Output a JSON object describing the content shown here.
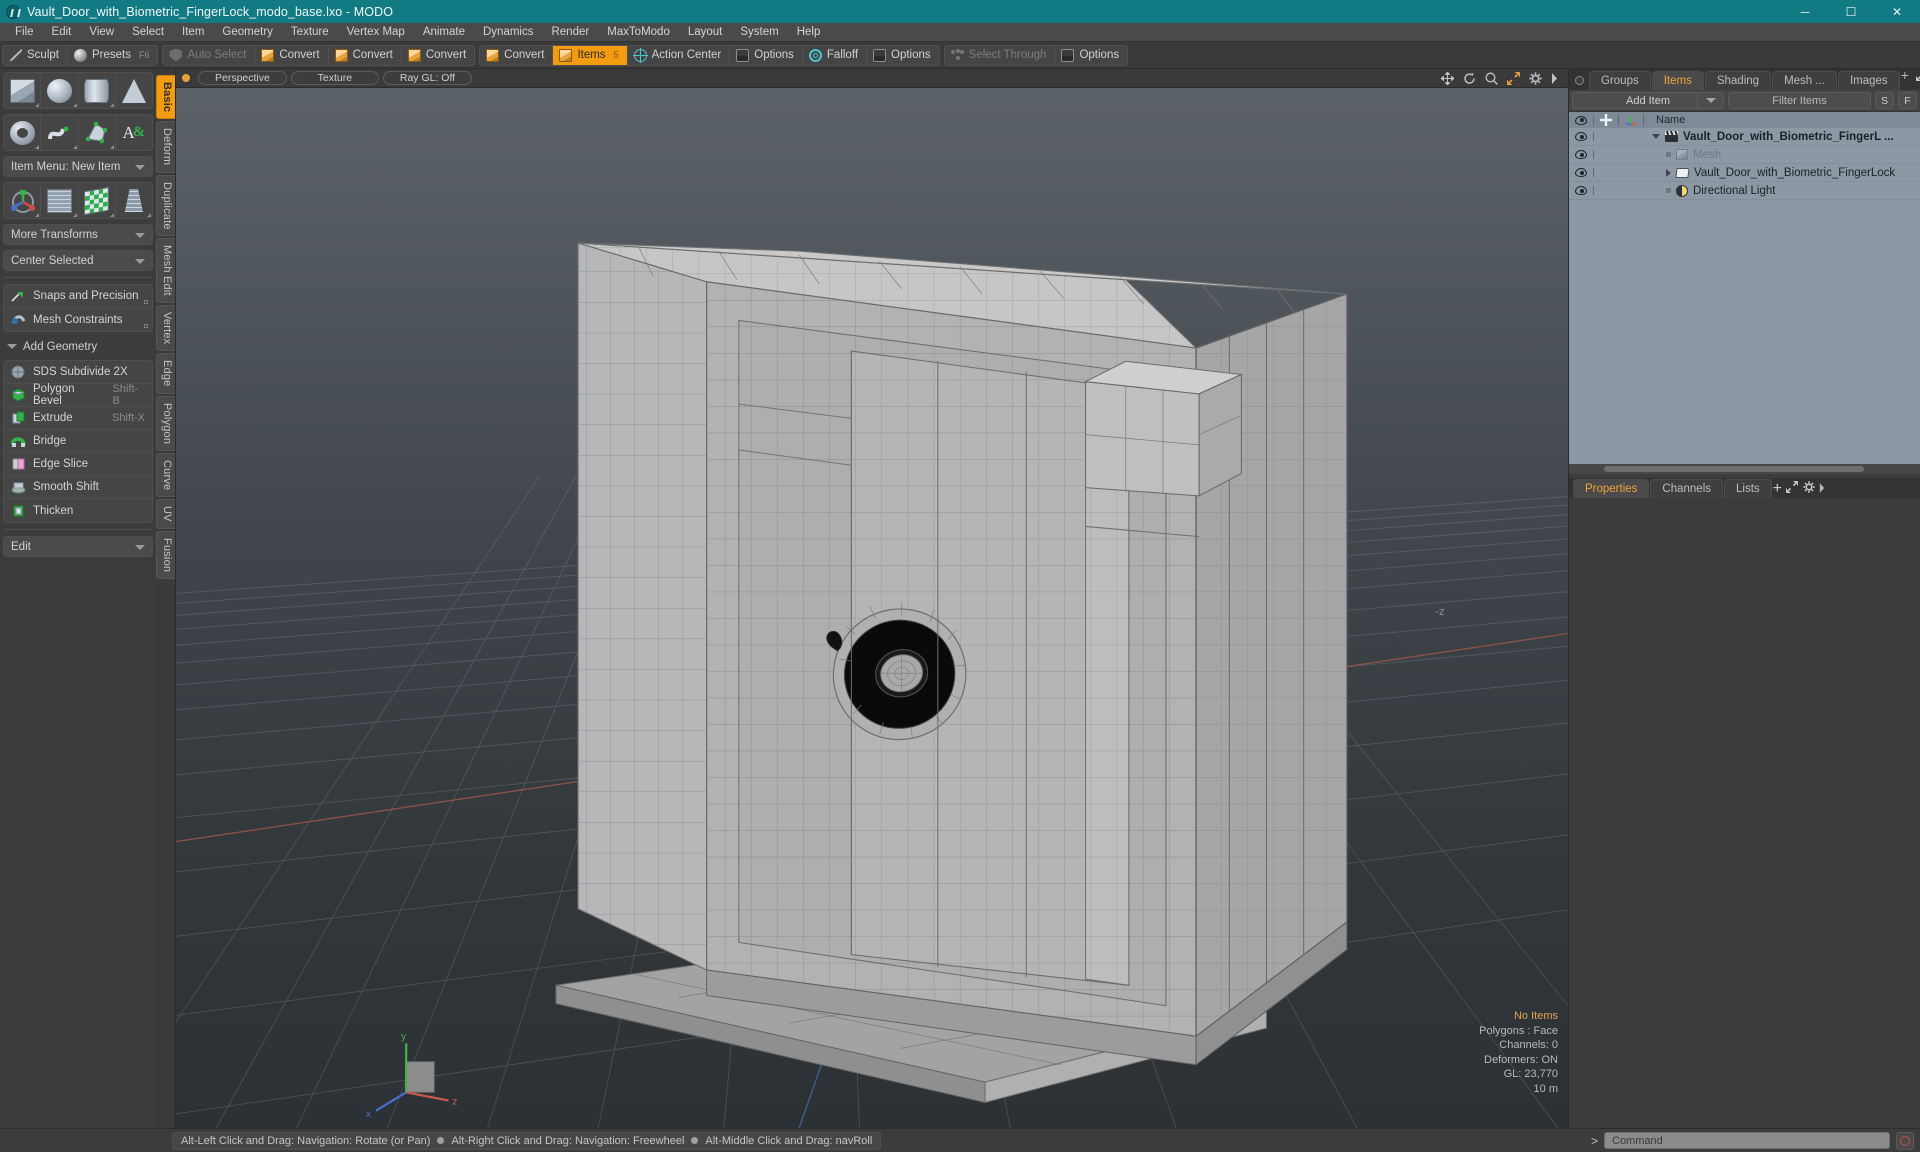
{
  "window": {
    "title": "Vault_Door_with_Biometric_FingerLock_modo_base.lxo - MODO",
    "logo_icon": "modo-logo-icon",
    "controls": [
      {
        "name": "minimize-button",
        "glyph": "─"
      },
      {
        "name": "maximize-button",
        "glyph": "☐"
      },
      {
        "name": "close-button",
        "glyph": "✕"
      }
    ]
  },
  "menubar": {
    "items": [
      "File",
      "Edit",
      "View",
      "Select",
      "Item",
      "Geometry",
      "Texture",
      "Vertex Map",
      "Animate",
      "Dynamics",
      "Render",
      "MaxToModo",
      "Layout",
      "System",
      "Help"
    ]
  },
  "modebar": {
    "group1": [
      {
        "label": "Sculpt",
        "icon": "pencil-icon",
        "state": "normal"
      },
      {
        "label": "Presets",
        "icon": "sphere-icon",
        "state": "normal",
        "shortcut": "F6"
      }
    ],
    "group2": [
      {
        "label": "Auto Select",
        "icon": "shield-icon",
        "state": "dim"
      },
      {
        "label": "Convert",
        "icon": "vertex-cube-icon",
        "state": "normal"
      },
      {
        "label": "Convert",
        "icon": "edge-cube-icon",
        "state": "normal"
      },
      {
        "label": "Convert",
        "icon": "polygon-cube-icon",
        "state": "normal"
      }
    ],
    "group3": [
      {
        "label": "Convert",
        "icon": "item-cube-icon",
        "state": "normal"
      },
      {
        "label": "Items",
        "icon": "items-cube-icon",
        "state": "active",
        "shortcut": "5"
      },
      {
        "label": "Action Center",
        "icon": "crosshair-circle-icon",
        "state": "normal"
      },
      {
        "label": "Options",
        "icon": "options-square-icon",
        "state": "normal"
      },
      {
        "label": "Falloff",
        "icon": "falloff-target-icon",
        "state": "normal"
      },
      {
        "label": "Options",
        "icon": "options-square-icon",
        "state": "normal"
      }
    ],
    "group4": [
      {
        "label": "Select Through",
        "icon": "nodes-icon",
        "state": "dim"
      },
      {
        "label": "Options",
        "icon": "options-square-icon",
        "state": "normal"
      }
    ]
  },
  "left_toolbox": {
    "primitives_row1": [
      {
        "name": "cube-primitive",
        "icon": "cube-icon"
      },
      {
        "name": "sphere-primitive",
        "icon": "sphere-icon"
      },
      {
        "name": "cylinder-primitive",
        "icon": "cylinder-icon"
      },
      {
        "name": "cone-primitive",
        "icon": "cone-icon"
      }
    ],
    "primitives_row2": [
      {
        "name": "torus-primitive",
        "icon": "torus-icon"
      },
      {
        "name": "curve-tool",
        "icon": "curve-icon"
      },
      {
        "name": "polygon-tool",
        "icon": "polygon-icon"
      },
      {
        "name": "text-tool",
        "icon": "text-icon"
      }
    ],
    "item_menu": "Item Menu: New Item",
    "transform_row": [
      {
        "name": "transform-tool",
        "icon": "axis-gizmo-icon"
      },
      {
        "name": "bend-tool",
        "icon": "grid-mesh-icon"
      },
      {
        "name": "shear-tool",
        "icon": "checker-icon"
      },
      {
        "name": "taper-tool",
        "icon": "taper-grid-icon"
      }
    ],
    "more_transforms": "More Transforms",
    "center_selected": "Center Selected",
    "snaps_items": [
      {
        "label": "Snaps and Precision",
        "icon": "snap-magnet-icon"
      },
      {
        "label": "Mesh Constraints",
        "icon": "mesh-constraint-icon"
      }
    ],
    "add_geometry_header": "Add Geometry",
    "geometry_items": [
      {
        "label": "SDS Subdivide 2X",
        "icon": "sds-subdivide-icon",
        "shortcut": ""
      },
      {
        "label": "Polygon Bevel",
        "icon": "bevel-cube-icon",
        "shortcut": "Shift-B"
      },
      {
        "label": "Extrude",
        "icon": "extrude-cube-icon",
        "shortcut": "Shift-X"
      },
      {
        "label": "Bridge",
        "icon": "bridge-icon",
        "shortcut": ""
      },
      {
        "label": "Edge Slice",
        "icon": "edge-slice-icon",
        "shortcut": ""
      },
      {
        "label": "Smooth Shift",
        "icon": "smooth-shift-icon",
        "shortcut": ""
      },
      {
        "label": "Thicken",
        "icon": "thicken-icon",
        "shortcut": ""
      }
    ],
    "edit_dropdown": "Edit",
    "vertical_tabs": [
      {
        "label": "Basic",
        "active": true
      },
      {
        "label": "Deform",
        "active": false
      },
      {
        "label": "Duplicate",
        "active": false
      },
      {
        "label": "Mesh Edit",
        "active": false
      },
      {
        "label": "Vertex",
        "active": false
      },
      {
        "label": "Edge",
        "active": false
      },
      {
        "label": "Polygon",
        "active": false
      },
      {
        "label": "Curve",
        "active": false
      },
      {
        "label": "UV",
        "active": false
      },
      {
        "label": "Fusion",
        "active": false
      }
    ]
  },
  "viewport": {
    "header_buttons": [
      "Perspective",
      "Texture",
      "Ray GL: Off"
    ],
    "header_icons": [
      "move-icon",
      "rotate-icon",
      "zoom-icon",
      "expand-icon",
      "gear-icon",
      "chevron-right-icon"
    ],
    "stats": {
      "selection": "No Items",
      "polygons": "Polygons : Face",
      "channels": "Channels: 0",
      "deformers": "Deformers: ON",
      "gl": "GL: 23,770",
      "scale": "10 m"
    },
    "axis_labels": {
      "x": "x",
      "y": "y",
      "z": "z"
    }
  },
  "right_panel": {
    "tabs": [
      {
        "label": "Groups",
        "active": false
      },
      {
        "label": "Items",
        "active": true
      },
      {
        "label": "Shading",
        "active": false
      },
      {
        "label": "Mesh ...",
        "active": false
      },
      {
        "label": "Images",
        "active": false
      }
    ],
    "tab_add": "+",
    "toolbar": {
      "add_item": "Add Item",
      "filter_placeholder": "Filter Items",
      "s_button": "S",
      "f_button": "F"
    },
    "tree_header": {
      "eye_col": "visibility-icon",
      "lock_col": "lock-icon",
      "axis_col": "axis-icon",
      "name_col": "Name"
    },
    "tree_rows": [
      {
        "label": "Vault_Door_with_Biometric_FingerL ...",
        "icon": "scene-clapper-icon",
        "indent": 0,
        "bold": true,
        "dim": false,
        "toggle": "down"
      },
      {
        "label": "Mesh",
        "icon": "mesh-cube-icon",
        "indent": 1,
        "bold": false,
        "dim": true,
        "toggle": "none"
      },
      {
        "label": "Vault_Door_with_Biometric_FingerLock",
        "icon": "mesh-folder-icon",
        "indent": 1,
        "bold": false,
        "dim": false,
        "toggle": "right"
      },
      {
        "label": "Directional Light",
        "icon": "directional-light-icon",
        "indent": 1,
        "bold": false,
        "dim": false,
        "toggle": "none"
      }
    ],
    "bottom_tabs": [
      {
        "label": "Properties",
        "active": true
      },
      {
        "label": "Channels",
        "active": false
      },
      {
        "label": "Lists",
        "active": false
      }
    ],
    "bottom_tab_add": "+"
  },
  "statusbar": {
    "hints": [
      "Alt-Left Click and Drag: Navigation: Rotate (or Pan)",
      "Alt-Right Click and Drag: Navigation: Freewheel",
      "Alt-Middle Click and Drag: navRoll"
    ],
    "command_prompt": ">",
    "command_placeholder": "Command",
    "record_button": "record-macro-icon"
  },
  "colors": {
    "title_bar": "#117a82",
    "accent_orange": "#f39c12",
    "panel_bg": "#3c3c3c",
    "tree_bg": "#8c98a4",
    "viewport_top": "#575e63",
    "viewport_bottom": "#2e3336"
  }
}
